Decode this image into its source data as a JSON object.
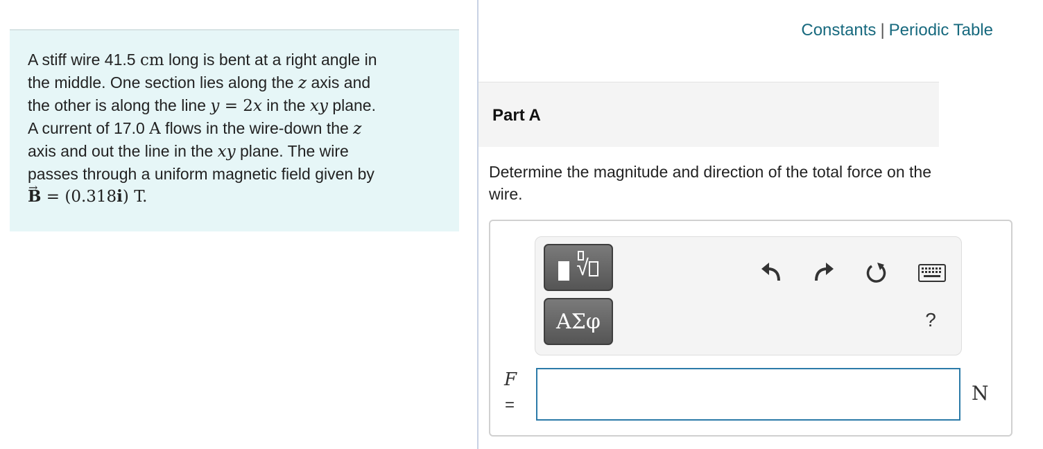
{
  "problem": {
    "line1_pre": "A stiff wire 41.5 ",
    "line1_unit": "cm",
    "line1_post": " long is bent at a right angle in",
    "line2_pre": "the middle. One section lies along the ",
    "line2_var": "z",
    "line2_post": " axis and",
    "line3_pre": "the other is along the line ",
    "line3_y": "y",
    "line3_eq": " = 2",
    "line3_x": "x",
    "line3_mid": " in the ",
    "line3_xy": "xy",
    "line3_post": " plane.",
    "line4_pre": "A current of 17.0 ",
    "line4_unit": "A",
    "line4_mid": " flows in the wire-down the ",
    "line4_var": "z",
    "line5_pre": "axis and out the line in the ",
    "line5_xy": "xy",
    "line5_post": " plane. The wire",
    "line6": "passes through a uniform magnetic field given by",
    "field_symbol": "B",
    "field_eq": " = (0.318",
    "field_unit_vector": "i",
    "field_close": ") T."
  },
  "links": {
    "constants": "Constants",
    "separator": "|",
    "periodic_table": "Periodic Table"
  },
  "part": {
    "title": "Part A",
    "question": "Determine the magnitude and direction of the total force on the wire."
  },
  "answer": {
    "variable": "F",
    "equals": "=",
    "value": "",
    "unit": "N"
  },
  "toolbar": {
    "symbols_label": "ΑΣφ",
    "help_label": "?"
  },
  "icons": {
    "templates": "templates-icon",
    "undo": "undo-icon",
    "redo": "redo-icon",
    "reset": "reset-icon",
    "keyboard": "keyboard-icon"
  },
  "colors": {
    "link": "#17697e",
    "problem_background": "#e6f6f7",
    "input_border": "#2b7aa8"
  }
}
